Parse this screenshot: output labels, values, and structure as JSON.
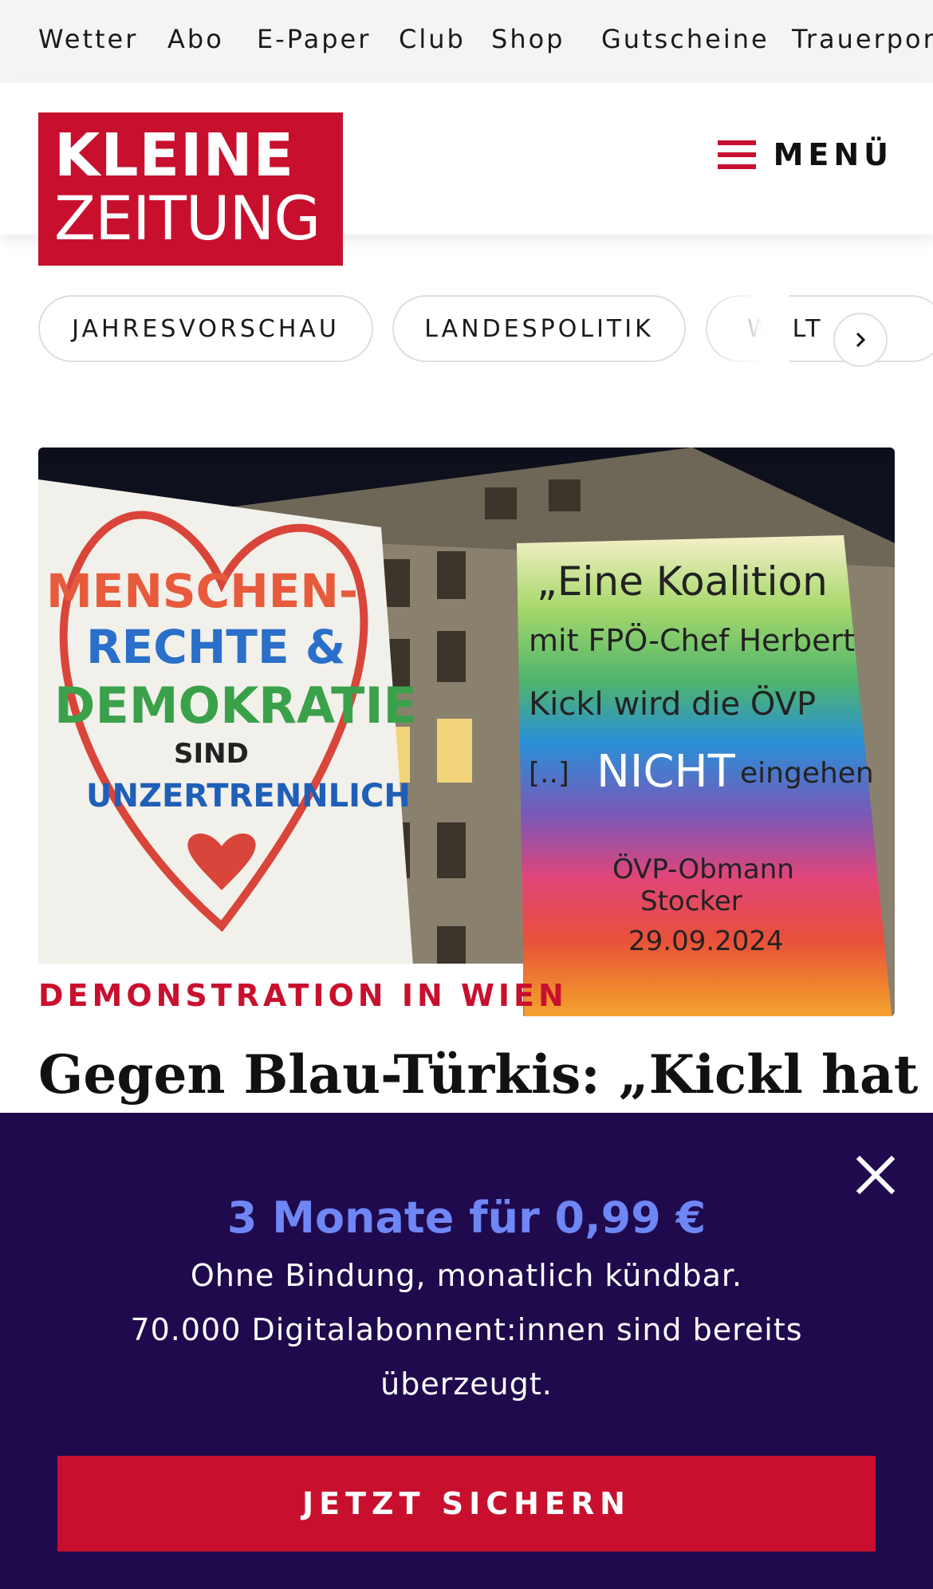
{
  "topbar": {
    "items": [
      "Wetter",
      "Abo",
      "E-Paper",
      "Club",
      "Shop",
      "Gutscheine",
      "Trauerportal"
    ]
  },
  "header": {
    "logo_line1": "KLEINE",
    "logo_line2": "ZEITUNG",
    "menu_label": "MENÜ"
  },
  "tags": {
    "items": [
      "JAHRESVORSCHAU",
      "LANDESPOLITIK",
      "WELT"
    ]
  },
  "article": {
    "image_sign_left": [
      "MENSCHEN-",
      "RECHTE &",
      "DEMOKRATIE",
      "SIND",
      "UNZERTRENNLICH"
    ],
    "image_sign_right": [
      "„Eine Koalition",
      "mit FPÖ-Chef Herbert",
      "Kickl wird die ÖVP",
      "[..] NICHT eingehen",
      "ÖVP-Obmann",
      "Stocker",
      "29.09.2024"
    ],
    "kicker": "DEMONSTRATION IN WIEN",
    "headline": "Gegen Blau-Türkis: „Kickl hat"
  },
  "overlay": {
    "title": "3 Monate für 0,99 €",
    "line1": "Ohne Bindung, monatlich kündbar.",
    "line2": "70.000 Digitalabonnent:innen sind bereits",
    "line3": "überzeugt.",
    "cta_label": "JETZT SICHERN",
    "close_icon": "close-icon"
  },
  "colors": {
    "brand_red": "#c8102e",
    "overlay_bg": "#1e0a4d",
    "offer_accent": "#6f86f5",
    "topbar_bg": "#f3f4f6"
  }
}
